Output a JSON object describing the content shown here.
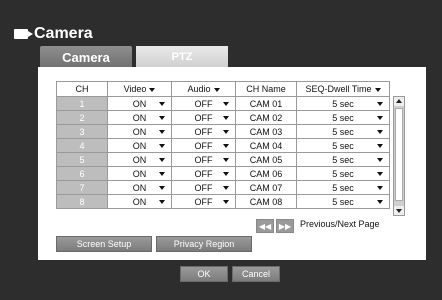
{
  "window": {
    "title": "Camera",
    "icon": "camera-icon"
  },
  "tabs": [
    {
      "label": "Camera",
      "active": true
    },
    {
      "label": "PTZ",
      "active": false
    }
  ],
  "table": {
    "headers": {
      "ch": "CH",
      "video": "Video",
      "audio": "Audio",
      "name": "CH Name",
      "seq": "SEQ-Dwell Time"
    },
    "rows": [
      {
        "ch": "1",
        "video": "ON",
        "audio": "OFF",
        "name": "CAM 01",
        "seq": "5 sec"
      },
      {
        "ch": "2",
        "video": "ON",
        "audio": "OFF",
        "name": "CAM 02",
        "seq": "5 sec"
      },
      {
        "ch": "3",
        "video": "ON",
        "audio": "OFF",
        "name": "CAM 03",
        "seq": "5 sec"
      },
      {
        "ch": "4",
        "video": "ON",
        "audio": "OFF",
        "name": "CAM 04",
        "seq": "5 sec"
      },
      {
        "ch": "5",
        "video": "ON",
        "audio": "OFF",
        "name": "CAM 05",
        "seq": "5 sec"
      },
      {
        "ch": "6",
        "video": "ON",
        "audio": "OFF",
        "name": "CAM 06",
        "seq": "5 sec"
      },
      {
        "ch": "7",
        "video": "ON",
        "audio": "OFF",
        "name": "CAM 07",
        "seq": "5 sec"
      },
      {
        "ch": "8",
        "video": "ON",
        "audio": "OFF",
        "name": "CAM 08",
        "seq": "5 sec"
      }
    ]
  },
  "pager": {
    "prev_icon": "rewind-icon",
    "next_icon": "fast-forward-icon",
    "label": "Previous/Next Page"
  },
  "buttons": {
    "screen_setup": "Screen Setup",
    "privacy_region": "Privacy Region",
    "ok": "OK",
    "cancel": "Cancel"
  }
}
